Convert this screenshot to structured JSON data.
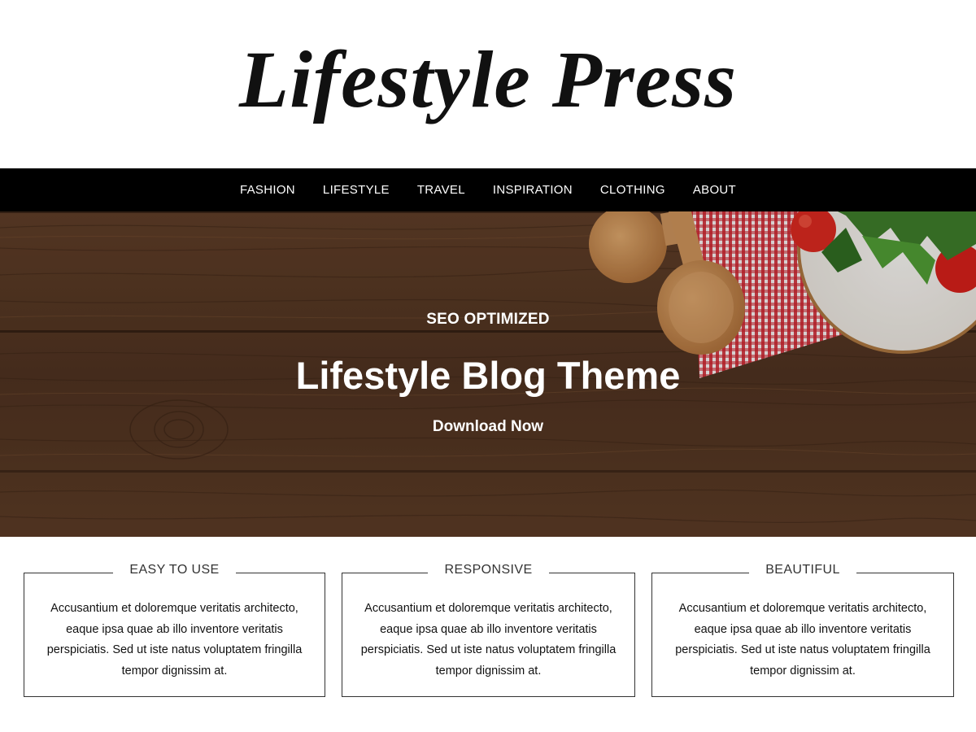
{
  "site": {
    "title": "Lifestyle Press"
  },
  "nav": {
    "items": [
      {
        "label": "FASHION"
      },
      {
        "label": "LIFESTYLE"
      },
      {
        "label": "TRAVEL"
      },
      {
        "label": "INSPIRATION"
      },
      {
        "label": "CLOTHING"
      },
      {
        "label": "ABOUT"
      }
    ]
  },
  "hero": {
    "subtitle": "SEO OPTIMIZED",
    "title": "Lifestyle Blog Theme",
    "cta_label": "Download Now",
    "background": "wood-table-with-spoons-and-salad"
  },
  "features": [
    {
      "heading": "EASY TO USE",
      "text": "Accusantium et doloremque veritatis architecto, eaque ipsa quae ab illo inventore veritatis perspiciatis. Sed ut iste natus voluptatem fringilla tempor dignissim at."
    },
    {
      "heading": "RESPONSIVE",
      "text": "Accusantium et doloremque veritatis architecto, eaque ipsa quae ab illo inventore veritatis perspiciatis. Sed ut iste natus voluptatem fringilla tempor dignissim at."
    },
    {
      "heading": "BEAUTIFUL",
      "text": "Accusantium et doloremque veritatis architecto, eaque ipsa quae ab illo inventore veritatis perspiciatis. Sed ut iste natus voluptatem fringilla tempor dignissim at."
    }
  ],
  "colors": {
    "nav_background": "#000000",
    "wood": "#5a3a26",
    "text": "#111111",
    "border": "#333333"
  }
}
